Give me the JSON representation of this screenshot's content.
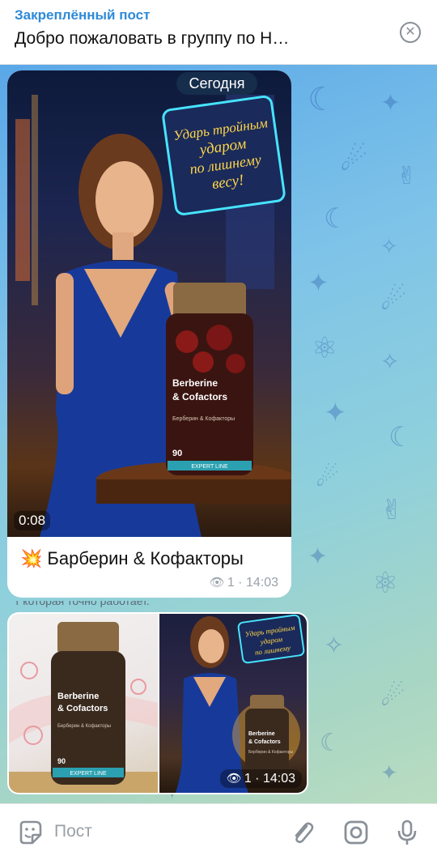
{
  "pinned": {
    "title": "Закреплённый пост",
    "text": "Добро пожаловать в группу по Н…",
    "close_icon": "close-circle-icon"
  },
  "message_video": {
    "date_label": "Сегодня",
    "duration": "0:08",
    "caption_emoji": "💥",
    "caption": "Барберин & Кофакторы",
    "views": "1",
    "time": "14:03",
    "video_sign_text": "Ударь тройным ударом по лишнему весу!",
    "product_name": "Berberine & Cofactors",
    "product_sub": "Берберин & Кофакторы",
    "product_count": "90",
    "product_line": "EXPERT LINE"
  },
  "album": {
    "cut_text": "т которая точно работает.",
    "views": "1",
    "time": "14:03",
    "left_product_name": "Berberine & Cofactors",
    "left_product_sub": "Берберин & Кофакторы",
    "left_product_count": "90",
    "left_product_line": "EXPERT LINE",
    "right_product_name": "Berberine & Cofactors",
    "right_product_sub": "Берберин & Кофакторы",
    "right_sign_text": "Ударь тройным ударом по лишнему"
  },
  "input": {
    "placeholder": "Пост",
    "left_icon": "sticker-icon",
    "icons": [
      "attach-icon",
      "camera-icon",
      "microphone-icon"
    ]
  },
  "colors": {
    "accent": "#2e8ad8",
    "muted": "#9aa0a6"
  }
}
